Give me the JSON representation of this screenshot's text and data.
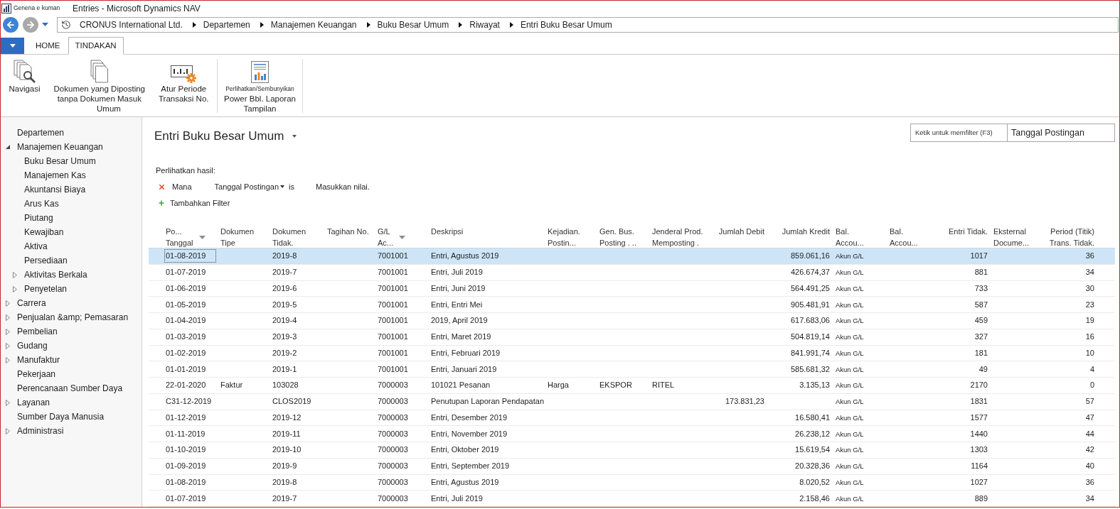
{
  "window": {
    "quick_access_label": "Genena e kuman",
    "title": "Entries - Microsoft Dynamics NAV"
  },
  "address_bar": {
    "breadcrumbs": [
      "CRONUS International Ltd.",
      "Departemen",
      "Manajemen Keuangan",
      "Buku Besar Umum",
      "Riwayat",
      "Entri Buku Besar Umum"
    ]
  },
  "ribbon": {
    "tabs": [
      {
        "label": "HOME",
        "selected": false
      },
      {
        "label": "TINDAKAN",
        "selected": true
      }
    ],
    "groups": [
      {
        "label": "Umum",
        "buttons": [
          {
            "kind": "navigate",
            "lines": [
              "Navigasi"
            ]
          },
          {
            "kind": "posted-documents",
            "lines": [
              "Dokumen yang Diposting",
              "tanpa Dokumen Masuk"
            ]
          },
          {
            "kind": "number-series",
            "lines": [
              "Atur Periode",
              "Transaksi No."
            ]
          }
        ]
      },
      {
        "label": "Tampilan",
        "buttons": [
          {
            "kind": "report",
            "caption": "Perlihatkan/Sembunyikan",
            "lines": [
              "Power Bbl. Laporan"
            ]
          }
        ]
      }
    ]
  },
  "sidebar": {
    "items": [
      {
        "label": "Departemen"
      },
      {
        "label": "Manajemen Keuangan",
        "expanded": true,
        "children": [
          {
            "label": "Buku Besar Umum"
          },
          {
            "label": "Manajemen Kas"
          },
          {
            "label": "Akuntansi Biaya"
          },
          {
            "label": "Arus Kas"
          },
          {
            "label": "Piutang"
          },
          {
            "label": "Kewajiban"
          },
          {
            "label": "Aktiva"
          },
          {
            "label": "Persediaan"
          },
          {
            "label": "Aktivitas Berkala",
            "expanded": false
          },
          {
            "label": "Penyetelan",
            "expanded": false
          }
        ]
      },
      {
        "label": "Carrera",
        "expanded": false
      },
      {
        "label": "Penjualan &amp; Pemasaran",
        "expanded": false
      },
      {
        "label": "Pembelian",
        "expanded": false
      },
      {
        "label": "Gudang",
        "expanded": false
      },
      {
        "label": "Manufaktur",
        "expanded": false
      },
      {
        "label": "Pekerjaan"
      },
      {
        "label": "Perencanaan Sumber Daya"
      },
      {
        "label": "Layanan",
        "expanded": false
      },
      {
        "label": "Sumber Daya Manusia"
      },
      {
        "label": "Administrasi",
        "expanded": false
      }
    ]
  },
  "page": {
    "title": "Entri Buku Besar Umum",
    "search": {
      "placeholder": "Ketik untuk memfilter (F3)",
      "field": "Tanggal Postingan"
    },
    "filter_panel": {
      "heading": "Perlihatkan hasil:",
      "filters": [
        {
          "label": "Mana",
          "field": "Tanggal Postingan",
          "operator": "is",
          "placeholder": "Masukkan nilai."
        }
      ],
      "add_filter": "Tambahkan Filter"
    }
  },
  "table": {
    "columns": [
      {
        "lines": [
          "Po...",
          "Tanggal"
        ],
        "sorted": true
      },
      {
        "lines": [
          "Dokumen",
          "Tipe"
        ],
        "sorted": false
      },
      {
        "lines": [
          "Dokumen",
          "Tidak."
        ],
        "sorted": false
      },
      {
        "lines": [
          "Tagihan No."
        ],
        "sorted": false
      },
      {
        "lines": [
          "G/L",
          "Ac..."
        ],
        "sorted": true
      },
      {
        "lines": [
          "Deskripsi"
        ],
        "sorted": false
      },
      {
        "lines": [
          "Kejadian.",
          "Postin..."
        ],
        "sorted": false
      },
      {
        "lines": [
          "Gen. Bus.",
          "Posting . .."
        ],
        "sorted": false
      },
      {
        "lines": [
          "Jenderal Prod.",
          "Memposting ."
        ],
        "sorted": false
      },
      {
        "lines": [
          "Jumlah Debit"
        ],
        "sorted": false
      },
      {
        "lines": [
          "Jumlah Kredit"
        ],
        "sorted": false
      },
      {
        "lines": [
          "Bal.",
          "Accou..."
        ],
        "sorted": false
      },
      {
        "lines": [
          "Bal.",
          "Accou..."
        ],
        "sorted": false
      },
      {
        "lines": [
          "Entri Tidak."
        ],
        "sorted": false
      },
      {
        "lines": [
          "Eksternal",
          "Docume..."
        ],
        "sorted": false
      },
      {
        "lines": [
          "Period (Titik)",
          "Trans. Tidak."
        ],
        "sorted": false
      }
    ],
    "rows": [
      {
        "selected": true,
        "posting_date": "01-08-2019",
        "document_no": "2019-8",
        "gl_account_no": "7001001",
        "description": "Entri, Agustus 2019",
        "credit_amount": "859.061,16",
        "bal_account_type": "Akun G/L",
        "entry_no": "1017",
        "transaction_no": "36"
      },
      {
        "selected": false,
        "posting_date": "01-07-2019",
        "document_no": "2019-7",
        "gl_account_no": "7001001",
        "description": "Entri, Juli 2019",
        "credit_amount": "426.674,37",
        "bal_account_type": "Akun G/L",
        "entry_no": "881",
        "transaction_no": "34"
      },
      {
        "selected": false,
        "posting_date": "01-06-2019",
        "document_no": "2019-6",
        "gl_account_no": "7001001",
        "description": "Entri, Juni 2019",
        "credit_amount": "564.491,25",
        "bal_account_type": "Akun G/L",
        "entry_no": "733",
        "transaction_no": "30"
      },
      {
        "selected": false,
        "posting_date": "01-05-2019",
        "document_no": "2019-5",
        "gl_account_no": "7001001",
        "description": "Entri, Entri Mei",
        "credit_amount": "905.481,91",
        "bal_account_type": "Akun G/L",
        "entry_no": "587",
        "transaction_no": "23"
      },
      {
        "selected": false,
        "posting_date": "01-04-2019",
        "document_no": "2019-4",
        "gl_account_no": "7001001",
        "description": "2019, April 2019",
        "credit_amount": "617.683,06",
        "bal_account_type": "Akun G/L",
        "entry_no": "459",
        "transaction_no": "19"
      },
      {
        "selected": false,
        "posting_date": "01-03-2019",
        "document_no": "2019-3",
        "gl_account_no": "7001001",
        "description": "Entri, Maret 2019",
        "credit_amount": "504.819,14",
        "bal_account_type": "Akun G/L",
        "entry_no": "327",
        "transaction_no": "16"
      },
      {
        "selected": false,
        "posting_date": "01-02-2019",
        "document_no": "2019-2",
        "gl_account_no": "7001001",
        "description": "Entri, Februari 2019",
        "credit_amount": "841.991,74",
        "bal_account_type": "Akun G/L",
        "entry_no": "181",
        "transaction_no": "10"
      },
      {
        "selected": false,
        "posting_date": "01-01-2019",
        "document_no": "2019-1",
        "gl_account_no": "7001001",
        "description": "Entri, Januari 2019",
        "credit_amount": "585.681,32",
        "bal_account_type": "Akun G/L",
        "entry_no": "49",
        "transaction_no": "4"
      },
      {
        "selected": false,
        "posting_date": "22-01-2020",
        "document_type": "Faktur",
        "document_no": "103028",
        "gl_account_no": "7000003",
        "description": "101021 Pesanan",
        "gen_posting_type": "Harga",
        "gen_bus_posting_group": "EKSPOR",
        "gen_prod_posting_group": "RITEL",
        "credit_amount": "3.135,13",
        "bal_account_type": "Akun G/L",
        "entry_no": "2170",
        "transaction_no": "0"
      },
      {
        "selected": false,
        "posting_date": "C31-12-2019",
        "document_no": "CLOS2019",
        "gl_account_no": "7000003",
        "description": "Penutupan Laporan Pendapatan",
        "debit_amount": "173.831,23",
        "bal_account_type": "Akun G/L",
        "entry_no": "1831",
        "transaction_no": "57"
      },
      {
        "selected": false,
        "posting_date": "01-12-2019",
        "document_no": "2019-12",
        "gl_account_no": "7000003",
        "description": "Entri, Desember 2019",
        "credit_amount": "16.580,41",
        "bal_account_type": "Akun G/L",
        "entry_no": "1577",
        "transaction_no": "47"
      },
      {
        "selected": false,
        "posting_date": "01-11-2019",
        "document_no": "2019-11",
        "gl_account_no": "7000003",
        "description": "Entri, November 2019",
        "credit_amount": "26.238,12",
        "bal_account_type": "Akun G/L",
        "entry_no": "1440",
        "transaction_no": "44"
      },
      {
        "selected": false,
        "posting_date": "01-10-2019",
        "document_no": "2019-10",
        "gl_account_no": "7000003",
        "description": "Entri, Oktober 2019",
        "credit_amount": "15.619,54",
        "bal_account_type": "Akun G/L",
        "entry_no": "1303",
        "transaction_no": "42"
      },
      {
        "selected": false,
        "posting_date": "01-09-2019",
        "document_no": "2019-9",
        "gl_account_no": "7000003",
        "description": "Entri, September 2019",
        "credit_amount": "20.328,36",
        "bal_account_type": "Akun G/L",
        "entry_no": "1164",
        "transaction_no": "40"
      },
      {
        "selected": false,
        "posting_date": "01-08-2019",
        "document_no": "2019-8",
        "gl_account_no": "7000003",
        "description": "Entri, Agustus 2019",
        "credit_amount": "8.020,52",
        "bal_account_type": "Akun G/L",
        "entry_no": "1027",
        "transaction_no": "36"
      },
      {
        "selected": false,
        "posting_date": "01-07-2019",
        "document_no": "2019-7",
        "gl_account_no": "7000003",
        "description": "Entri, Juli 2019",
        "credit_amount": "2.158,46",
        "bal_account_type": "Akun G/L",
        "entry_no": "889",
        "transaction_no": "34"
      }
    ]
  }
}
